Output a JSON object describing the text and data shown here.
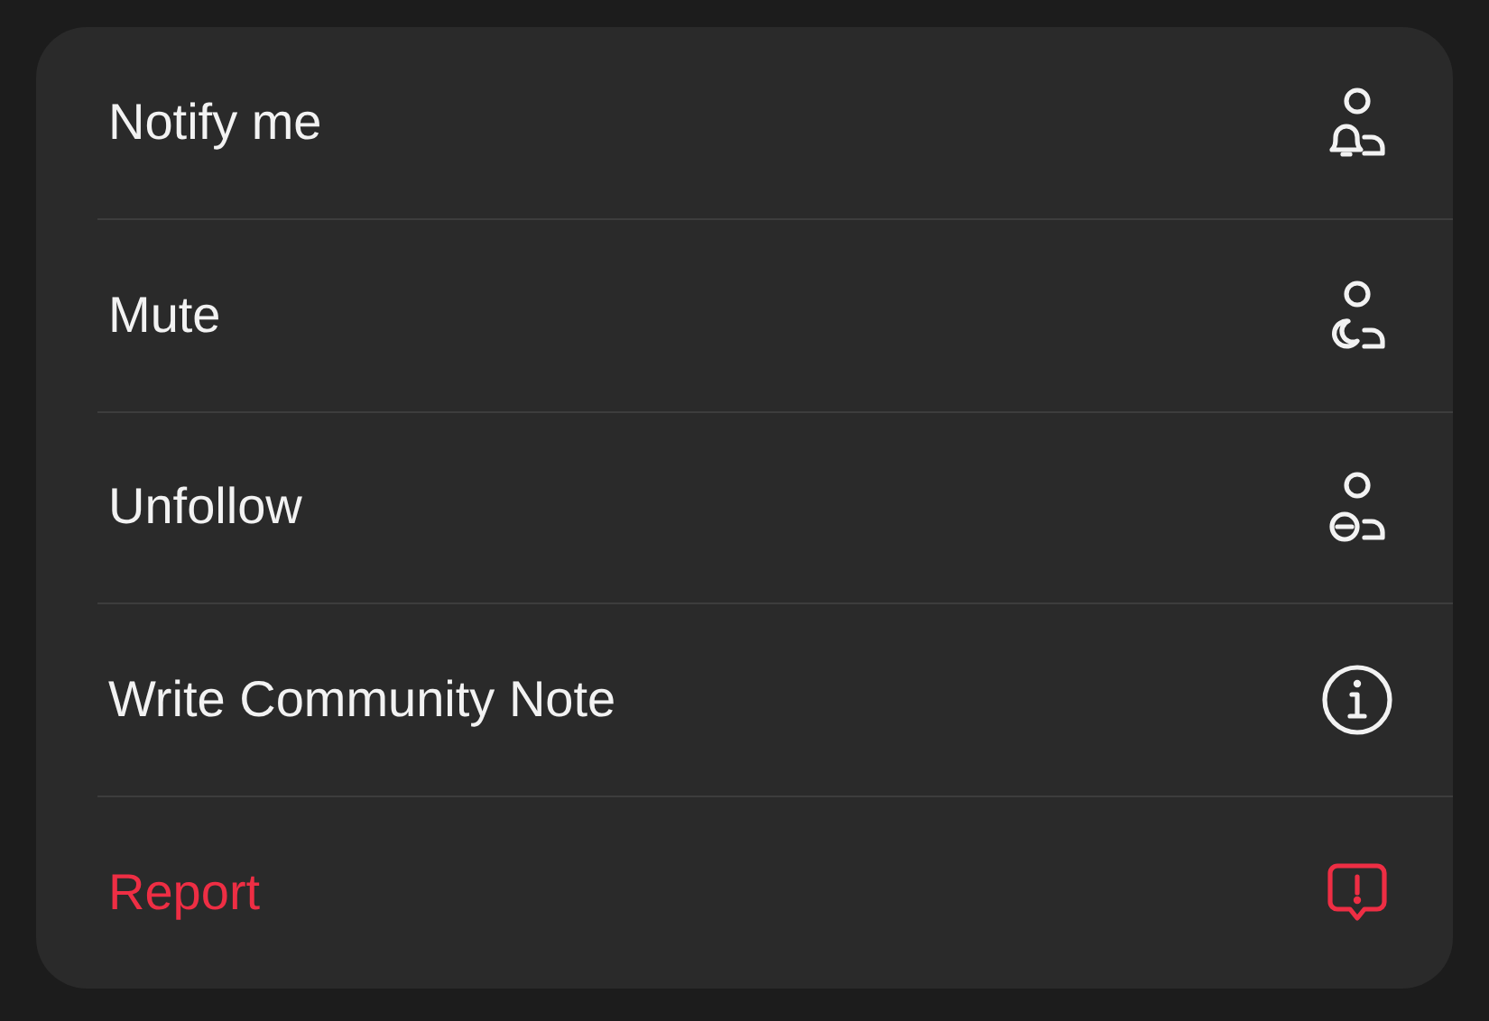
{
  "menu": [
    {
      "label": "Notify me",
      "kind": "notify",
      "destructive": false
    },
    {
      "label": "Mute",
      "kind": "mute",
      "destructive": false
    },
    {
      "label": "Unfollow",
      "kind": "unfollow",
      "destructive": false
    },
    {
      "label": "Write Community Note",
      "kind": "note",
      "destructive": false
    },
    {
      "label": "Report",
      "kind": "report",
      "destructive": true
    }
  ]
}
